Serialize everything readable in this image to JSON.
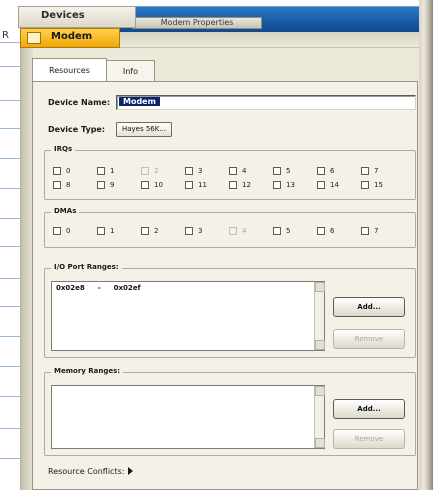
{
  "tree": {
    "parent_label": "Devices",
    "selected_label": "Modem",
    "prefix": "R"
  },
  "window": {
    "title": "Modem Properties"
  },
  "tabs": [
    {
      "label": "Resources",
      "active": true
    },
    {
      "label": "Info",
      "active": false
    }
  ],
  "device": {
    "name_label": "Device Name:",
    "name_value": "Modem",
    "type_label": "Device Type:",
    "type_value": "Hayes 56K..."
  },
  "irqs": {
    "title": "IRQs",
    "items": [
      {
        "label": "0",
        "disabled": false
      },
      {
        "label": "1",
        "disabled": false
      },
      {
        "label": "2",
        "disabled": true
      },
      {
        "label": "3",
        "disabled": false
      },
      {
        "label": "4",
        "disabled": false
      },
      {
        "label": "5",
        "disabled": false
      },
      {
        "label": "6",
        "disabled": false
      },
      {
        "label": "7",
        "disabled": false
      },
      {
        "label": "8",
        "disabled": false
      },
      {
        "label": "9",
        "disabled": false
      },
      {
        "label": "10",
        "disabled": false
      },
      {
        "label": "11",
        "disabled": false
      },
      {
        "label": "12",
        "disabled": false
      },
      {
        "label": "13",
        "disabled": false
      },
      {
        "label": "14",
        "disabled": false
      },
      {
        "label": "15",
        "disabled": false
      }
    ]
  },
  "dmas": {
    "title": "DMAs",
    "items": [
      {
        "label": "0",
        "disabled": false
      },
      {
        "label": "1",
        "disabled": false
      },
      {
        "label": "2",
        "disabled": false
      },
      {
        "label": "3",
        "disabled": false
      },
      {
        "label": "4",
        "disabled": true
      },
      {
        "label": "5",
        "disabled": false
      },
      {
        "label": "6",
        "disabled": false
      },
      {
        "label": "7",
        "disabled": false
      }
    ]
  },
  "io_ranges": {
    "title": "I/O Port Ranges:",
    "entry_start": "0x02e8",
    "entry_sep": "-",
    "entry_end": "0x02ef",
    "add_label": "Add...",
    "remove_label": "Remove"
  },
  "memory_ranges": {
    "title": "Memory Ranges:",
    "add_label": "Add...",
    "remove_label": "Remove"
  },
  "conflicts": {
    "label": "Resource Conflicts:"
  },
  "colors": {
    "titlebar": "#185aa3",
    "selected_tree": "#f0a60c",
    "panel": "#ece9d8",
    "selection": "#0a246a"
  }
}
